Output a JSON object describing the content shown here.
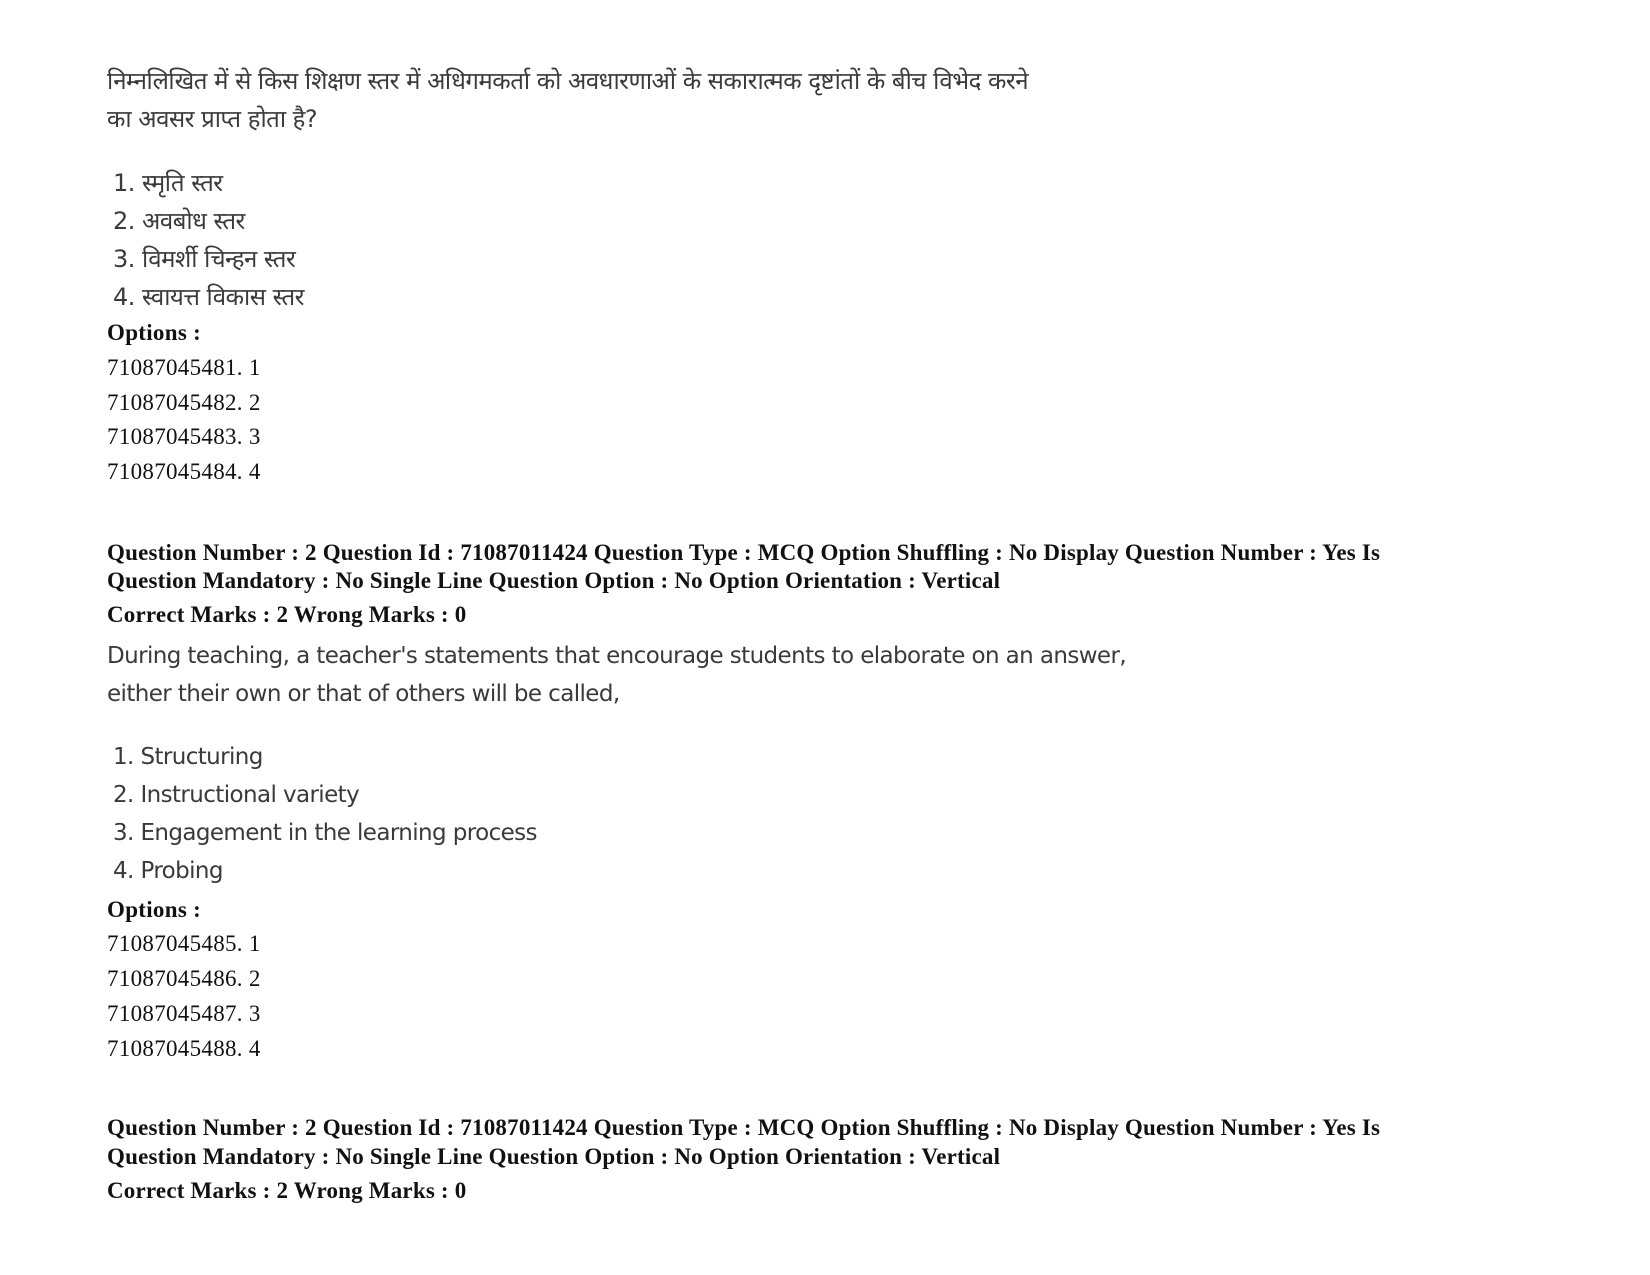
{
  "question1": {
    "text_line1": "निम्नलिखित में से किस शिक्षण स्तर में अधिगमकर्ता को अवधारणाओं के सकारात्मक दृष्टांतों के बीच विभेद करने",
    "text_line2": "का अवसर प्राप्त होता है?",
    "choices": [
      "1. स्मृति स्तर",
      "2. अवबोध स्तर",
      "3. विमर्शी चिन्हन स्तर",
      "4. स्वायत्त विकास स्तर"
    ],
    "options_label": "Options :",
    "options": [
      "71087045481. 1",
      "71087045482. 2",
      "71087045483. 3",
      "71087045484. 4"
    ]
  },
  "question2": {
    "meta_line1": "Question Number : 2 Question Id : 71087011424 Question Type : MCQ Option Shuffling : No Display Question Number : Yes Is",
    "meta_line2": "Question Mandatory : No Single Line Question Option : No Option Orientation : Vertical",
    "marks": "Correct Marks : 2 Wrong Marks : 0",
    "text_line1": "During teaching, a teacher's statements that encourage students to elaborate on an answer,",
    "text_line2": "either their own or that of others will be called,",
    "choices": [
      "1. Structuring",
      "2. Instructional variety",
      "3. Engagement in the learning process",
      "4. Probing"
    ],
    "options_label": "Options :",
    "options": [
      "71087045485. 1",
      "71087045486. 2",
      "71087045487. 3",
      "71087045488. 4"
    ]
  },
  "question3": {
    "meta_line1": "Question Number : 2 Question Id : 71087011424 Question Type : MCQ Option Shuffling : No Display Question Number : Yes Is",
    "meta_line2": "Question Mandatory : No Single Line Question Option : No Option Orientation : Vertical",
    "marks": "Correct Marks : 2 Wrong Marks : 0"
  }
}
